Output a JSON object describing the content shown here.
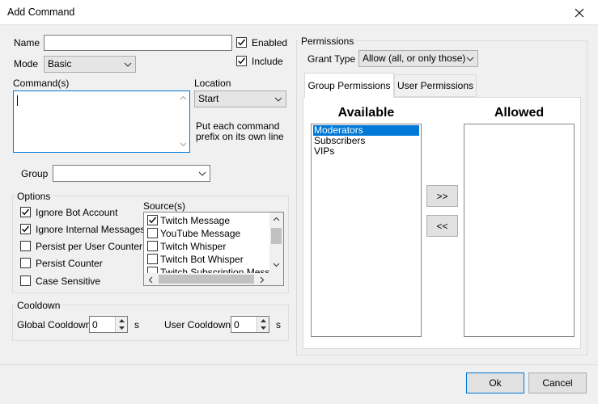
{
  "window": {
    "title": "Add Command"
  },
  "form": {
    "name_label": "Name",
    "name_value": "",
    "enabled_label": "Enabled",
    "enabled_checked": true,
    "mode_label": "Mode",
    "mode_value": "Basic",
    "include_label": "Include",
    "include_checked": true,
    "commands_label": "Command(s)",
    "commands_value": "",
    "location_label": "Location",
    "location_value": "Start",
    "hint": "Put each command prefix on its own line",
    "group_label": "Group",
    "group_value": ""
  },
  "options": {
    "title": "Options",
    "items": [
      {
        "label": "Ignore Bot Account",
        "checked": true
      },
      {
        "label": "Ignore Internal Messages",
        "checked": true
      },
      {
        "label": "Persist per User Counter",
        "checked": false
      },
      {
        "label": "Persist Counter",
        "checked": false
      },
      {
        "label": "Case Sensitive",
        "checked": false
      }
    ],
    "sources_label": "Source(s)",
    "sources": [
      {
        "label": "Twitch Message",
        "checked": true
      },
      {
        "label": "YouTube Message",
        "checked": false
      },
      {
        "label": "Twitch Whisper",
        "checked": false
      },
      {
        "label": "Twitch Bot Whisper",
        "checked": false
      },
      {
        "label": "Twitch Subscription Message",
        "checked": false
      }
    ]
  },
  "cooldown": {
    "title": "Cooldown",
    "global_label": "Global Cooldown",
    "global_value": "0",
    "global_unit": "s",
    "user_label": "User Cooldown",
    "user_value": "0",
    "user_unit": "s"
  },
  "permissions": {
    "title": "Permissions",
    "grant_type_label": "Grant Type",
    "grant_type_value": "Allow (all, or only those)",
    "tabs": [
      {
        "label": "Group Permissions",
        "active": true
      },
      {
        "label": "User Permissions",
        "active": false
      }
    ],
    "available_title": "Available",
    "allowed_title": "Allowed",
    "available_items": [
      "Moderators",
      "Subscribers",
      "VIPs"
    ],
    "selected_index": 0,
    "allowed_items": [],
    "add_button": ">>",
    "remove_button": "<<"
  },
  "footer": {
    "ok_label": "Ok",
    "cancel_label": "Cancel"
  },
  "colors": {
    "accent": "#0078d7",
    "selection": "#0078d7"
  }
}
